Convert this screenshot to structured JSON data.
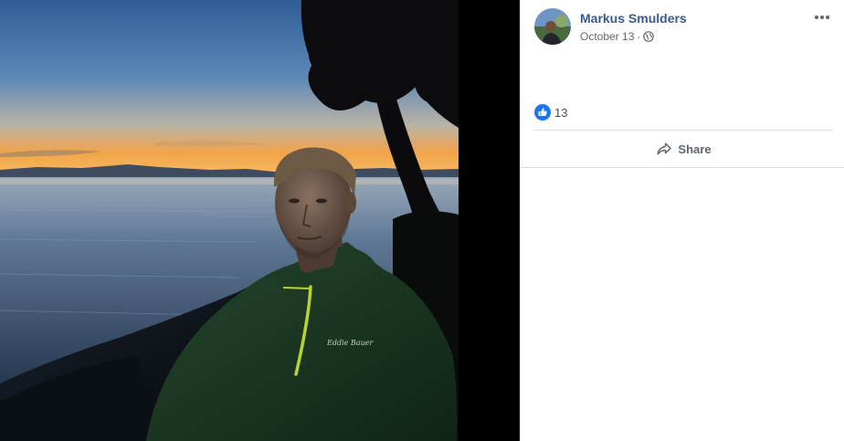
{
  "post": {
    "author_name": "Markus Smulders",
    "date": "October 13",
    "meta_separator": "·",
    "privacy_icon": "globe-icon",
    "more_icon": "more-options-icon"
  },
  "photo": {
    "subject": "portrait-at-sunset",
    "colors": {
      "sky_top": "#3f6a9e",
      "sky_horizon": "#f2a44a",
      "water": "#5c7592",
      "jacket": "#17341f",
      "zipper": "#b6d52a"
    }
  },
  "reactions": {
    "icon": "like-icon",
    "count": "13"
  },
  "actions": {
    "share_label": "Share",
    "share_icon": "share-icon"
  },
  "colors": {
    "name_link": "#385898",
    "meta_text": "#616770",
    "like_blue": "#1877f2",
    "divider": "#dadde1"
  }
}
